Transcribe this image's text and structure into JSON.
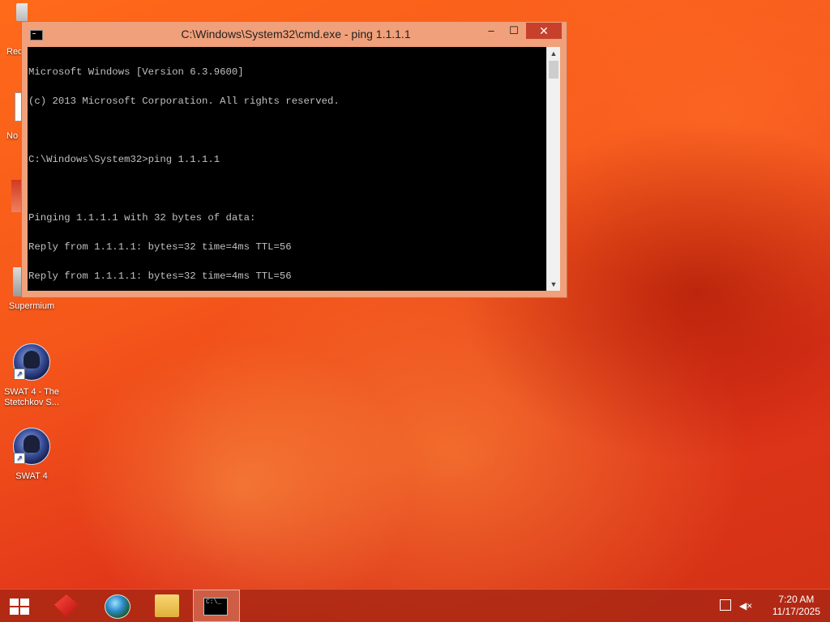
{
  "desktop": {
    "edge_icons": [
      {
        "label": "Rec",
        "icon": "recycle-bin-icon"
      },
      {
        "label": "No",
        "icon": "notepad-icon"
      }
    ],
    "icons": [
      {
        "label": "Supermium",
        "icon": "supermium-icon"
      },
      {
        "label": "SWAT 4 - The Stetchkov S...",
        "icon": "swat4-expansion-icon"
      },
      {
        "label": "SWAT 4",
        "icon": "swat4-icon"
      }
    ]
  },
  "cmd_window": {
    "title": "C:\\Windows\\System32\\cmd.exe - ping  1.1.1.1",
    "minimize": "–",
    "maximize": "☐",
    "close": "✕",
    "lines": [
      "Microsoft Windows [Version 6.3.9600]",
      "(c) 2013 Microsoft Corporation. All rights reserved.",
      "",
      "C:\\Windows\\System32>ping 1.1.1.1",
      "",
      "Pinging 1.1.1.1 with 32 bytes of data:",
      "Reply from 1.1.1.1: bytes=32 time=4ms TTL=56",
      "Reply from 1.1.1.1: bytes=32 time=4ms TTL=56"
    ],
    "scroll_up": "▲",
    "scroll_down": "▼"
  },
  "taskbar": {
    "pinned": [
      {
        "name": "red-app-icon"
      },
      {
        "name": "globe-browser-icon"
      },
      {
        "name": "file-explorer-icon"
      },
      {
        "name": "command-prompt-icon",
        "active": true
      }
    ],
    "cmd_glyph": "C:\\_",
    "clock_time": "7:20 AM",
    "clock_date": "11/17/2025",
    "speaker_glyph": "◀×"
  }
}
